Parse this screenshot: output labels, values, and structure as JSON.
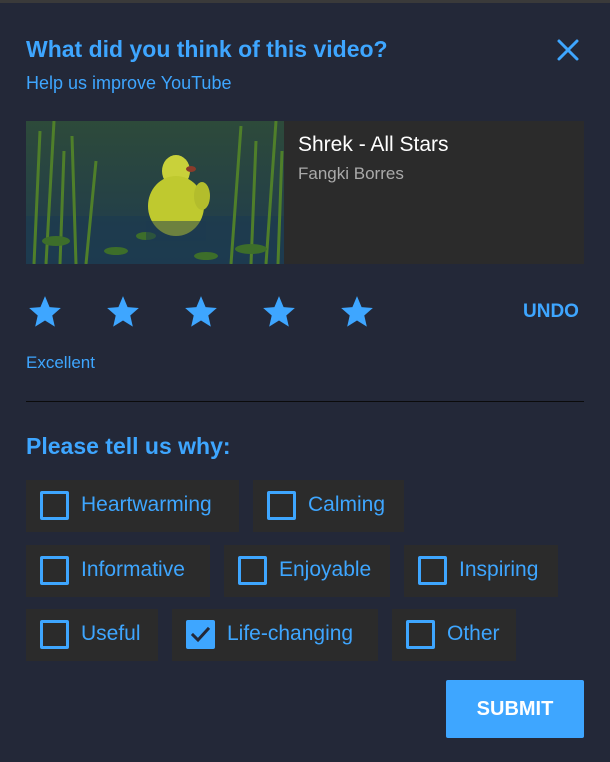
{
  "dialog": {
    "title": "What did you think of this video?",
    "subtitle": "Help us improve YouTube",
    "close_icon": "close-icon"
  },
  "video": {
    "title": "Shrek - All Stars",
    "channel": "Fangki Borres"
  },
  "rating": {
    "stars_total": 5,
    "stars_filled": 5,
    "undo_label": "UNDO",
    "label": "Excellent"
  },
  "reasons": {
    "heading": "Please tell us why:",
    "options": [
      {
        "label": "Heartwarming",
        "checked": false
      },
      {
        "label": "Calming",
        "checked": false
      },
      {
        "label": "Informative",
        "checked": false
      },
      {
        "label": "Enjoyable",
        "checked": false
      },
      {
        "label": "Inspiring",
        "checked": false
      },
      {
        "label": "Useful",
        "checked": false
      },
      {
        "label": "Life-changing",
        "checked": true
      },
      {
        "label": "Other",
        "checked": false
      }
    ]
  },
  "submit_label": "SUBMIT",
  "colors": {
    "background": "#232838",
    "accent": "#3ea6ff",
    "card": "#2b2b2b"
  }
}
